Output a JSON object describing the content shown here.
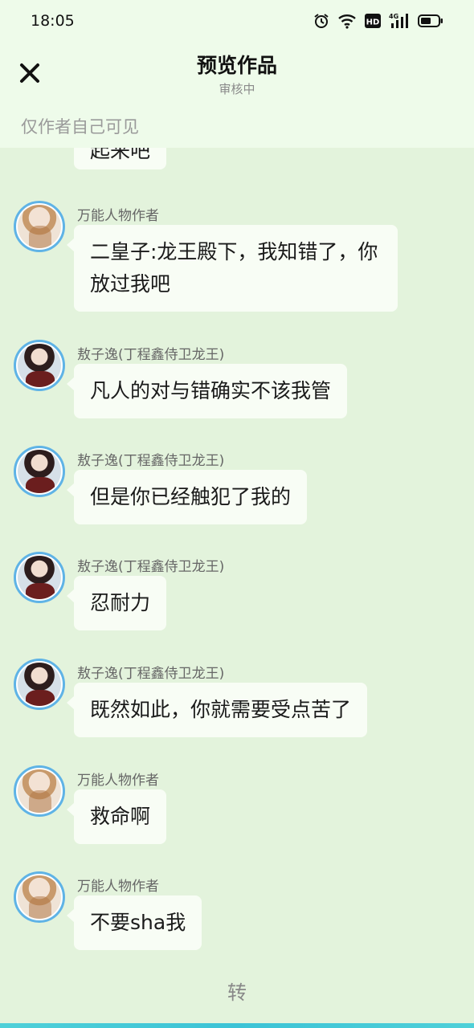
{
  "status": {
    "time": "18:05",
    "network": "4G",
    "hd": "HD"
  },
  "header": {
    "title": "预览作品",
    "subtitle": "审核中",
    "notice": "仅作者自己可见"
  },
  "messages": [
    {
      "text": "起来吧"
    },
    {
      "name": "万能人物作者",
      "text": "二皇子:龙王殿下，我知错了，你放过我吧"
    },
    {
      "name": "敖子逸(丁程鑫侍卫龙王)",
      "text": "凡人的对与错确实不该我管"
    },
    {
      "name": "敖子逸(丁程鑫侍卫龙王)",
      "text": "但是你已经触犯了我的"
    },
    {
      "name": "敖子逸(丁程鑫侍卫龙王)",
      "text": "忍耐力"
    },
    {
      "name": "敖子逸(丁程鑫侍卫龙王)",
      "text": "既然如此，你就需要受点苦了"
    },
    {
      "name": "万能人物作者",
      "text": "救命啊"
    },
    {
      "name": "万能人物作者",
      "text": "不要sha我"
    }
  ],
  "footer": {
    "turn_label": "转"
  }
}
